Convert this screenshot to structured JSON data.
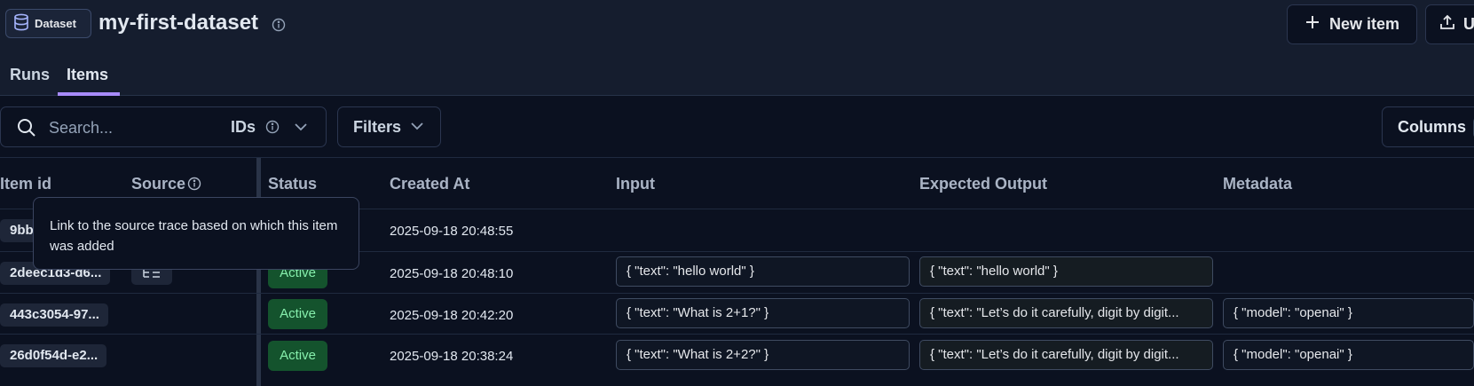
{
  "header": {
    "badge_label": "Dataset",
    "title": "my-first-dataset",
    "new_item_label": "New item",
    "upload_label": "U"
  },
  "tabs": [
    {
      "label": "Runs",
      "active": false
    },
    {
      "label": "Items",
      "active": true
    }
  ],
  "toolbar": {
    "search_placeholder": "Search...",
    "search_value": "",
    "search_mode": "IDs",
    "filters_label": "Filters",
    "columns_label": "Columns"
  },
  "table": {
    "headers": {
      "item_id": "Item id",
      "source": "Source",
      "status": "Status",
      "created_at": "Created At",
      "input": "Input",
      "expected_output": "Expected Output",
      "metadata": "Metadata"
    },
    "rows": [
      {
        "id": "9bb",
        "source": "",
        "status": "",
        "created_at": "2025-09-18 20:48:55",
        "input": "",
        "expected_output": "",
        "metadata": ""
      },
      {
        "id": "2deec1d3-d6...",
        "source": "trace-link",
        "status": "Active",
        "created_at": "2025-09-18 20:48:10",
        "input": "{ \"text\": \"hello world\" }",
        "expected_output": "{ \"text\": \"hello world\" }",
        "metadata": ""
      },
      {
        "id": "443c3054-97...",
        "source": "",
        "status": "Active",
        "created_at": "2025-09-18 20:42:20",
        "input": "{ \"text\": \"What is 2+1?\" }",
        "expected_output": "{ \"text\": \"Let’s do it carefully, digit by digit...",
        "metadata": "{ \"model\": \"openai\" }"
      },
      {
        "id": "26d0f54d-e2...",
        "source": "",
        "status": "Active",
        "created_at": "2025-09-18 20:38:24",
        "input": "{ \"text\": \"What is 2+2?\" }",
        "expected_output": "{ \"text\": \"Let’s do it carefully, digit by digit...",
        "metadata": "{ \"model\": \"openai\" }"
      }
    ]
  },
  "tooltip": {
    "text": "Link to the source trace based on which this item was added"
  },
  "colors": {
    "accent": "#a78bfa",
    "active_badge_bg": "#14532d",
    "active_badge_text": "#86efac"
  }
}
